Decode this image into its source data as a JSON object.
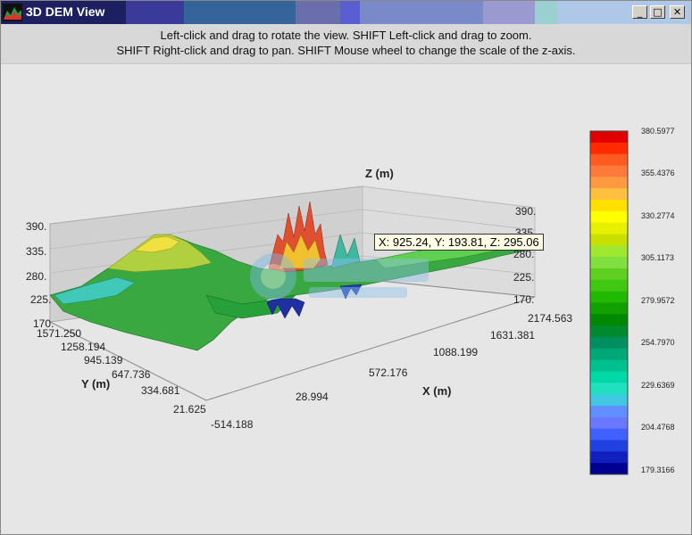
{
  "window": {
    "title": "3D DEM View",
    "title_colors": [
      "#1f2b6e",
      "#3a3a9a",
      "#34559a",
      "#3d6aa0",
      "#6a6ea8",
      "#5a5ec8",
      "#7a8ac8",
      "#9a9ad0",
      "#9ad0d0",
      "#b0c8e8"
    ],
    "buttons": {
      "minimize": "_",
      "maximize": "□",
      "close": "✕"
    }
  },
  "instructions": {
    "line1": "Left-click and drag to rotate the view. SHIFT Left-click and drag to zoom.",
    "line2": "SHIFT Right-click and drag to pan. SHIFT Mouse wheel to change the scale of the z-axis."
  },
  "plot": {
    "z_axis": {
      "label": "Z (m)",
      "ticks": [
        "390.",
        "335.",
        "280.",
        "225.",
        "170."
      ],
      "right_ticks": [
        "390.",
        "335.",
        "280.",
        "225.",
        "170."
      ]
    },
    "y_axis": {
      "label": "Y (m)",
      "ticks": [
        "1571.250",
        "1258.194",
        "945.139",
        "647.736",
        "334.681",
        "21.625"
      ]
    },
    "x_axis": {
      "label": "X (m)",
      "ticks": [
        "-514.188",
        "28.994",
        "572.176",
        "1088.199",
        "1631.381",
        "2174.563"
      ]
    },
    "tooltip": "X: 925.24, Y: 193.81, Z: 295.06"
  },
  "colorbar": {
    "labels": [
      "380.5977",
      "355.4376",
      "330.2774",
      "305.1173",
      "279.9572",
      "254.7970",
      "229.6369",
      "204.4768",
      "179.3166"
    ],
    "colors": [
      "#e00000",
      "#ff2a00",
      "#ff5a20",
      "#ff7a3a",
      "#ff9a40",
      "#ffc040",
      "#ffe000",
      "#ffff00",
      "#e8f000",
      "#c8e000",
      "#a0e830",
      "#80e040",
      "#60d020",
      "#40c810",
      "#20b800",
      "#10a000",
      "#008800",
      "#008a30",
      "#009060",
      "#00a878",
      "#00c090",
      "#00d8a8",
      "#20e0c0",
      "#40c8e0",
      "#6090ff",
      "#6a78ff",
      "#4060ff",
      "#2040e0",
      "#1020c0",
      "#000090"
    ]
  }
}
